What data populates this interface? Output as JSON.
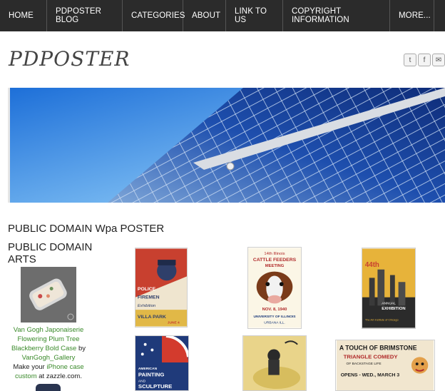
{
  "nav": {
    "items": [
      "HOME",
      "PDPOSTER BLOG",
      "CATEGORIES",
      "ABOUT",
      "LINK TO US",
      "COPYRIGHT INFORMATION",
      "MORE..."
    ]
  },
  "site": {
    "logo": "PDPOSTER",
    "social": [
      {
        "icon": "twitter-icon",
        "glyph": "t"
      },
      {
        "icon": "facebook-icon",
        "glyph": "f"
      },
      {
        "icon": "mail-icon",
        "glyph": "✉"
      }
    ]
  },
  "main": {
    "heading": "PUBLIC DOMAIN Wpa POSTER"
  },
  "sidebar": {
    "heading": "PUBLIC DOMAIN ARTS",
    "product": {
      "title_link": "Van Gogh Japonaiserie Flowering Plum Tree Blackberry Bold Case",
      "by": " by ",
      "author_link": "VanGogh_Gallery",
      "make_text": "Make your ",
      "custom_link": "iPhone case custom",
      "suffix": " at zazzle.com."
    }
  },
  "posters": [
    {
      "text": [
        "POLICE",
        "FIREMEN",
        "Exhibition",
        "VILLA PARK",
        "JUNE 4"
      ]
    },
    {
      "text": [
        "14th Illinois",
        "CATTLE FEEDERS",
        "MEETING",
        "NOV. 8, 1940",
        "UNIVERSITY OF ILLINOIS",
        "URBANA ILL."
      ]
    },
    {
      "text": [
        "44th",
        "ANNUAL",
        "EXHIBITION",
        "The Art Institute of Chicago"
      ]
    },
    {
      "text": [
        "AMERICAN",
        "PAINTING",
        "AND",
        "SCULPTURE"
      ]
    },
    {
      "text": []
    },
    {
      "text": [
        "A TOUCH OF BRIMSTONE",
        "TRIANGLE COMEDY",
        "OF BACKSTAGE LIFE",
        "OPENS - WED., MARCH 3"
      ]
    }
  ]
}
